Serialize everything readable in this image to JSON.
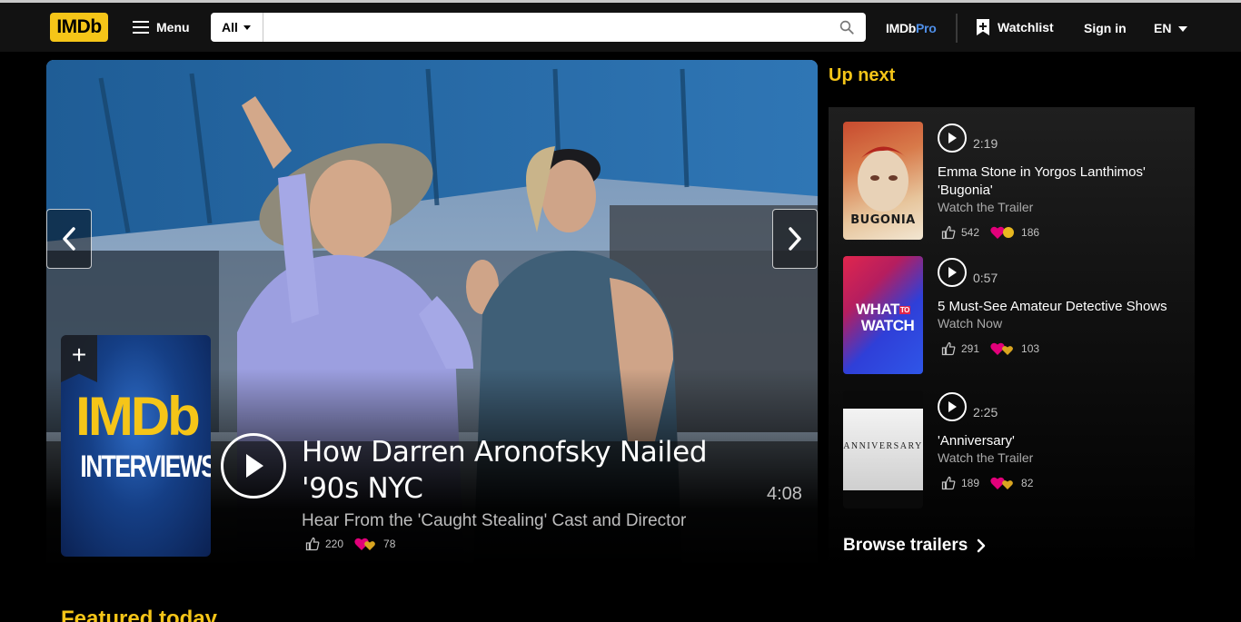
{
  "header": {
    "logo": "IMDb",
    "menu_label": "Menu",
    "search_category": "All",
    "search_value": "",
    "search_placeholder": "",
    "pro_prefix": "IMDb",
    "pro_suffix": "Pro",
    "watchlist_label": "Watchlist",
    "signin_label": "Sign in",
    "language": "EN"
  },
  "hero": {
    "title": "How Darren Aronofsky Nailed '90s NYC",
    "subtitle": "Hear From the 'Caught Stealing' Cast and Director",
    "duration": "4:08",
    "likes": "220",
    "loves": "78",
    "poster_line1": "IMDb",
    "poster_line2": "INTERVIEWS"
  },
  "up_next": {
    "heading": "Up next",
    "items": [
      {
        "duration": "2:19",
        "title": "Emma Stone in Yorgos Lanthimos' 'Bugonia'",
        "subtitle": "Watch the Trailer",
        "likes": "542",
        "loves": "186",
        "poster_text": "BUGONIA"
      },
      {
        "duration": "0:57",
        "title": "5 Must-See Amateur Detective Shows",
        "subtitle": "Watch Now",
        "likes": "291",
        "loves": "103",
        "poster_text_1": "WHAT",
        "poster_text_to": "TO",
        "poster_text_2": "WATCH"
      },
      {
        "duration": "2:25",
        "title": "'Anniversary'",
        "subtitle": "Watch the Trailer",
        "likes": "189",
        "loves": "82",
        "poster_text": "ANNIVERSARY"
      }
    ],
    "browse_label": "Browse trailers"
  },
  "featured_heading": "Featured today",
  "colors": {
    "accent": "#f5c518",
    "pro_blue": "#4f8fe8",
    "background": "#000000",
    "header_bg": "#121212"
  }
}
